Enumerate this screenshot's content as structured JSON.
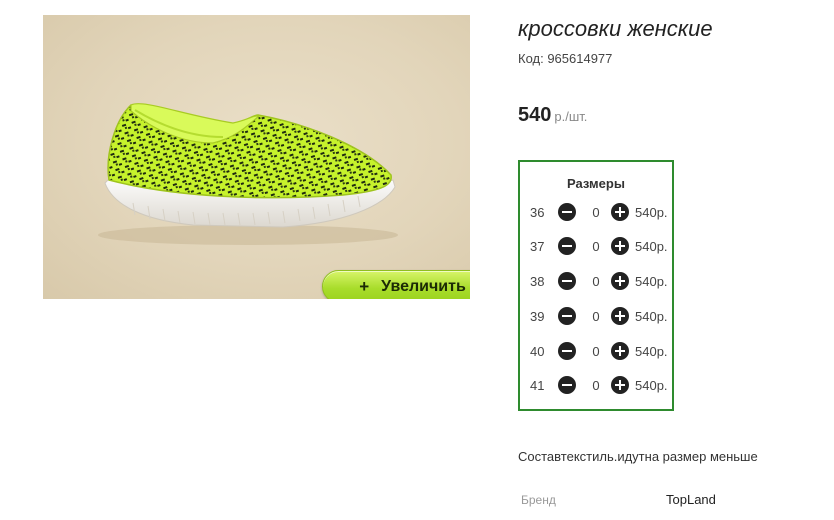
{
  "product": {
    "title": "кроссовки женские",
    "code": "Код: 965614977",
    "price_amount": "540",
    "price_unit": "р./шт.",
    "zoom_label": "Увеличить",
    "zoom_icon": "plus-icon"
  },
  "sizes": {
    "heading": "Размеры",
    "rows": [
      {
        "size": "36",
        "qty": "0",
        "price": "540р."
      },
      {
        "size": "37",
        "qty": "0",
        "price": "540р."
      },
      {
        "size": "38",
        "qty": "0",
        "price": "540р."
      },
      {
        "size": "39",
        "qty": "0",
        "price": "540р."
      },
      {
        "size": "40",
        "qty": "0",
        "price": "540р."
      },
      {
        "size": "41",
        "qty": "0",
        "price": "540р."
      }
    ]
  },
  "description": "Составтекстиль.идутна размер меньше",
  "brand": {
    "label": "Бренд",
    "value": "TopLand"
  },
  "colors": {
    "sizes_border": "#2e8b2e",
    "zoom_button": "#a9dd2c",
    "shoe_upper": "#c4f02a"
  }
}
